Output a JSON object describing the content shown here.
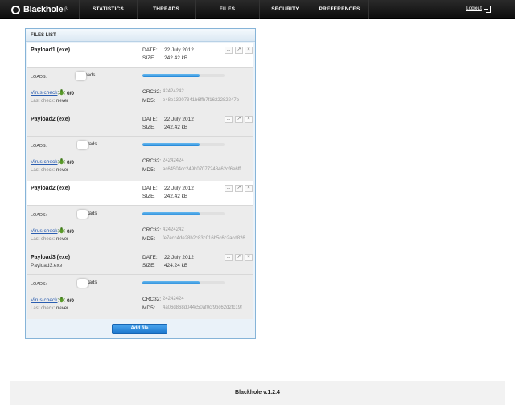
{
  "app": {
    "logo_text": "Blackhole",
    "logo_sup": "β"
  },
  "nav": {
    "items": [
      "STATISTICS",
      "THREADS",
      "FILES",
      "SECURITY",
      "PREFERENCES"
    ],
    "logout": "Logout"
  },
  "panel": {
    "title": "FILES LIST",
    "labels": {
      "date": "DATE:",
      "size": "SIZE:",
      "loads": "LOADS:",
      "crc": "CRC32:",
      "md5": "MD5:",
      "virus_check": "Virus check",
      "last_check": "Last check:"
    },
    "controls": [
      "...",
      "↗",
      "×"
    ],
    "files": [
      {
        "name": "Payload1 (exe)",
        "sub": "",
        "date": "22 July 2012",
        "size": "242.42 kB",
        "toggle_text": "loads",
        "progress": 0.7,
        "virus": "0/0",
        "last_check": "never",
        "crc": "42424242",
        "md5": "e48e13207341b6ffb7f1622282247b"
      },
      {
        "name": "Payload2 (exe)",
        "sub": "",
        "date": "22 July 2012",
        "size": "242.42 kB",
        "toggle_text": "loads",
        "progress": 0.7,
        "virus": "0/0",
        "last_check": "never",
        "crc": "24242424",
        "md5": "ac64504cc249b07077248462cf6e6ff"
      },
      {
        "name": "Payload2 (exe)",
        "sub": "",
        "date": "22 July 2012",
        "size": "242.42 kB",
        "toggle_text": "loads",
        "progress": 0.7,
        "virus": "0/0",
        "last_check": "never",
        "crc": "42424242",
        "md5": "fe7ecc4de28b2c83c016b5c6c2acd826"
      },
      {
        "name": "Payload3 (exe)",
        "sub": "Payload3.exe",
        "date": "22 July 2012",
        "size": "424.24 kB",
        "toggle_text": "loads",
        "progress": 0.7,
        "virus": "0/0",
        "last_check": "never",
        "crc": "24242424",
        "md5": "4a06d868d044c50af0cf9bc62d2fc19f"
      }
    ],
    "add_button": "Add file"
  },
  "footer": {
    "text": "Blackhole v.1.2.4"
  }
}
